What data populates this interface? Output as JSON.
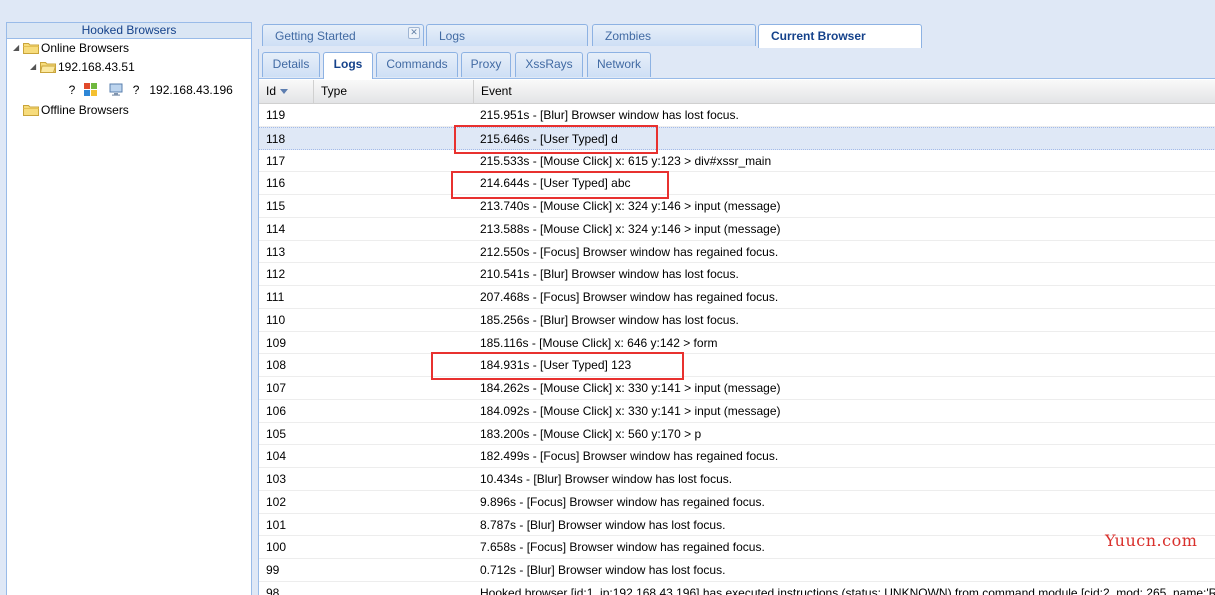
{
  "left_panel": {
    "title": "Hooked Browsers",
    "online_label": "Online Browsers",
    "host_ip": "192.168.43.51",
    "question_mark": "?",
    "browser_ip": "192.168.43.196",
    "offline_label": "Offline Browsers"
  },
  "outer_tabs": [
    {
      "label": "Getting Started",
      "closable": true
    },
    {
      "label": "Logs"
    },
    {
      "label": "Zombies"
    },
    {
      "label": "Current Browser",
      "active": true
    }
  ],
  "inner_tabs": [
    {
      "label": "Details"
    },
    {
      "label": "Logs",
      "active": true
    },
    {
      "label": "Commands"
    },
    {
      "label": "Proxy"
    },
    {
      "label": "XssRays"
    },
    {
      "label": "Network"
    }
  ],
  "grid": {
    "columns": {
      "id": "Id",
      "type": "Type",
      "event": "Event"
    },
    "rows": [
      {
        "id": "119",
        "type": "",
        "event": "215.951s - [Blur] Browser window has lost focus."
      },
      {
        "id": "118",
        "type": "",
        "event": "215.646s - [User Typed] d",
        "selected": true
      },
      {
        "id": "117",
        "type": "",
        "event": "215.533s - [Mouse Click] x: 615 y:123 > div#xssr_main"
      },
      {
        "id": "116",
        "type": "",
        "event": "214.644s - [User Typed] abc"
      },
      {
        "id": "115",
        "type": "",
        "event": "213.740s - [Mouse Click] x: 324 y:146 > input (message)"
      },
      {
        "id": "114",
        "type": "",
        "event": "213.588s - [Mouse Click] x: 324 y:146 > input (message)"
      },
      {
        "id": "113",
        "type": "",
        "event": "212.550s - [Focus] Browser window has regained focus."
      },
      {
        "id": "112",
        "type": "",
        "event": "210.541s - [Blur] Browser window has lost focus."
      },
      {
        "id": "111",
        "type": "",
        "event": "207.468s - [Focus] Browser window has regained focus."
      },
      {
        "id": "110",
        "type": "",
        "event": "185.256s - [Blur] Browser window has lost focus."
      },
      {
        "id": "109",
        "type": "",
        "event": "185.116s - [Mouse Click] x: 646 y:142 > form"
      },
      {
        "id": "108",
        "type": "",
        "event": "184.931s - [User Typed] 123"
      },
      {
        "id": "107",
        "type": "",
        "event": "184.262s - [Mouse Click] x: 330 y:141 > input (message)"
      },
      {
        "id": "106",
        "type": "",
        "event": "184.092s - [Mouse Click] x: 330 y:141 > input (message)"
      },
      {
        "id": "105",
        "type": "",
        "event": "183.200s - [Mouse Click] x: 560 y:170 > p"
      },
      {
        "id": "104",
        "type": "",
        "event": "182.499s - [Focus] Browser window has regained focus."
      },
      {
        "id": "103",
        "type": "",
        "event": "10.434s - [Blur] Browser window has lost focus."
      },
      {
        "id": "102",
        "type": "",
        "event": "9.896s - [Focus] Browser window has regained focus."
      },
      {
        "id": "101",
        "type": "",
        "event": "8.787s - [Blur] Browser window has lost focus."
      },
      {
        "id": "100",
        "type": "",
        "event": "7.658s - [Focus] Browser window has regained focus."
      },
      {
        "id": "99",
        "type": "",
        "event": "0.712s - [Blur] Browser window has lost focus."
      },
      {
        "id": "98",
        "type": "",
        "event": "Hooked browser [id:1, ip:192.168.43.196] has executed instructions (status: UNKNOWN) from command module [cid:2, mod: 265, name:'R"
      }
    ]
  },
  "highlighted_row_ids": [
    "118",
    "116",
    "108"
  ],
  "colors": {
    "highlight": "#e8312f",
    "accent": "#15428b",
    "selected_row": "#dfe8f6",
    "watermark": "#d9302c"
  },
  "watermark": "Yuucn.com"
}
